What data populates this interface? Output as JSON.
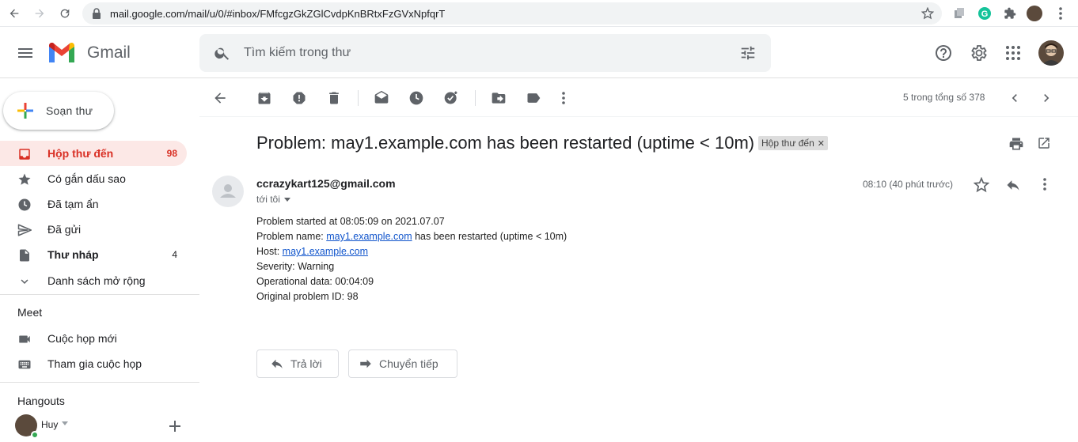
{
  "browser": {
    "url": "mail.google.com/mail/u/0/#inbox/FMfcgzGkZGlCvdpKnBRtxFzGVxNpfqrT"
  },
  "header": {
    "app_name": "Gmail",
    "search_placeholder": "Tìm kiếm trong thư"
  },
  "sidebar": {
    "compose_label": "Soạn thư",
    "items": [
      {
        "label": "Hộp thư đến",
        "count": "98",
        "icon": "inbox-icon"
      },
      {
        "label": "Có gắn dấu sao",
        "count": "",
        "icon": "star-icon"
      },
      {
        "label": "Đã tạm ẩn",
        "count": "",
        "icon": "clock-icon"
      },
      {
        "label": "Đã gửi",
        "count": "",
        "icon": "send-icon"
      },
      {
        "label": "Thư nháp",
        "count": "4",
        "icon": "draft-icon"
      },
      {
        "label": "Danh sách mở rộng",
        "count": "",
        "icon": "chevron-down-icon"
      }
    ],
    "meet_title": "Meet",
    "meet_items": [
      {
        "label": "Cuộc họp mới",
        "icon": "videocam-icon"
      },
      {
        "label": "Tham gia cuộc họp",
        "icon": "keyboard-icon"
      }
    ],
    "hangouts_title": "Hangouts",
    "hangouts_user": "Huy"
  },
  "toolbar": {
    "pager_text": "5 trong tổng số 378"
  },
  "message": {
    "subject": "Problem: may1.example.com has been restarted (uptime < 10m)",
    "label": "Hộp thư đến",
    "sender": "ccrazykart125@gmail.com",
    "to": "tới tôi",
    "time": "08:10 (40 phút trước)",
    "body": {
      "line1": "Problem started at 08:05:09 on 2021.07.07",
      "line2_prefix": "Problem name: ",
      "line2_link": "may1.example.com",
      "line2_suffix": " has been restarted (uptime < 10m)",
      "line3_prefix": "Host: ",
      "line3_link": "may1.example.com",
      "line4": "Severity: Warning",
      "line5": "Operational data: 00:04:09",
      "line6": "Original problem ID: 98"
    },
    "reply_label": "Trả lời",
    "forward_label": "Chuyển tiếp"
  },
  "colors": {
    "active_bg": "#fce8e6",
    "active_text": "#d93025",
    "link": "#1155cc"
  }
}
